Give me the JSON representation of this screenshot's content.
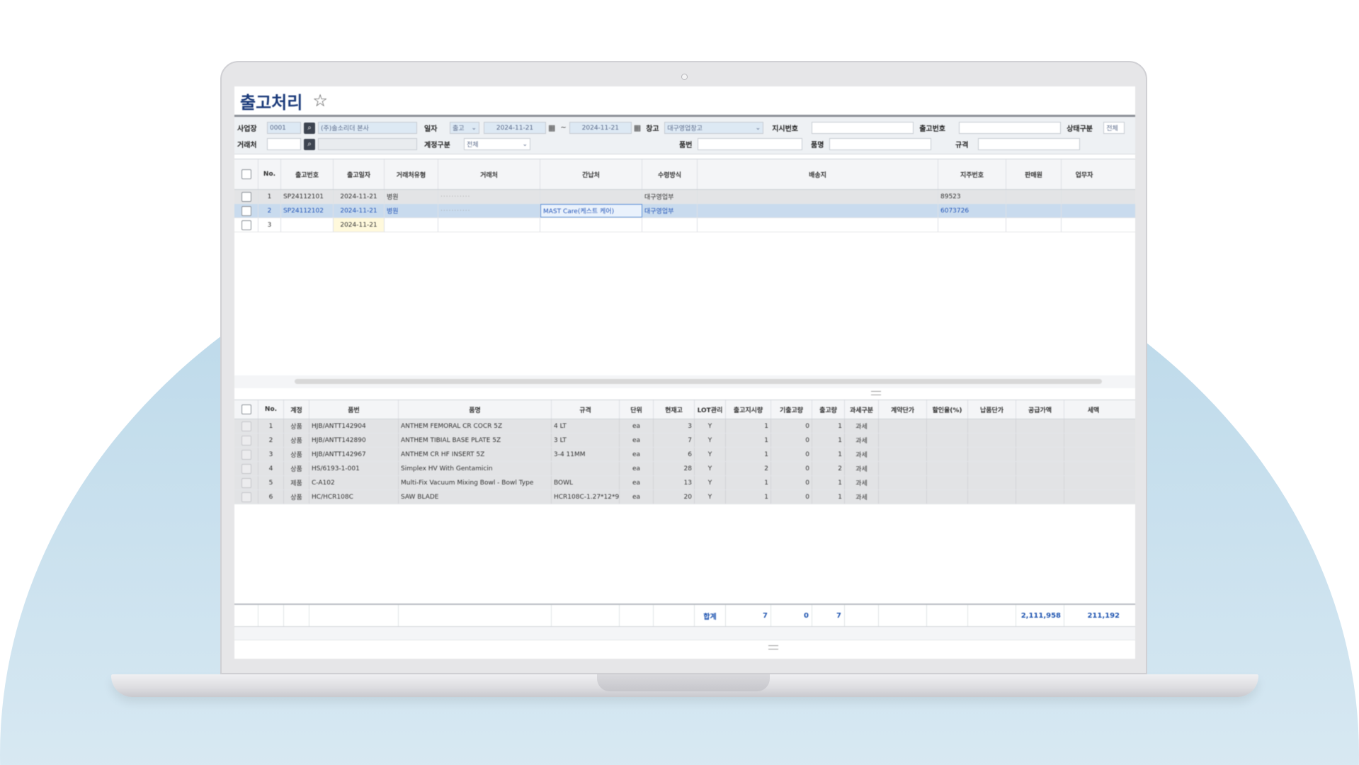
{
  "page": {
    "title": "출고처리",
    "star_icon": "star-icon"
  },
  "filters": {
    "row1": {
      "site_label": "사업장",
      "site_code": "0001",
      "site_name": "(주)솔소리더 본사",
      "date_label": "일자",
      "date_type": "출고",
      "date_from": "2024-11-21",
      "date_sep": "~",
      "date_to": "2024-11-21",
      "warehouse_label": "창고",
      "warehouse_value": "대구영업창고",
      "instruction_no_label": "지시번호",
      "instruction_no_value": "",
      "ship_no_label": "출고번호",
      "ship_no_value": "",
      "status_label": "상태구분",
      "status_value": "전체"
    },
    "row2": {
      "client_label": "거래처",
      "client_value": "",
      "account_label": "계정구분",
      "account_value": "전체",
      "item_no_label": "품번",
      "item_no_value": "",
      "item_name_label": "품명",
      "item_name_value": "",
      "spec_label": "규격",
      "spec_value": ""
    }
  },
  "master_grid": {
    "columns": [
      "No.",
      "출고번호",
      "출고일자",
      "거래처유형",
      "거래처",
      "간납처",
      "수령방식",
      "배송지",
      "지주번호",
      "판매원",
      "업무자"
    ],
    "rows": [
      {
        "no": "1",
        "ship_no": "SP24112101",
        "date": "2024-11-21",
        "type": "병원",
        "client": "···········",
        "agent": "",
        "method": "대구영업부",
        "address": "",
        "ref": "89523",
        "seller": "",
        "worker": ""
      },
      {
        "no": "2",
        "ship_no": "SP24112102",
        "date": "2024-11-21",
        "type": "병원",
        "client": "···········",
        "agent": "MAST Care(케스트 케어)",
        "method": "대구영업부",
        "address": "",
        "ref": "6073726",
        "seller": "",
        "worker": ""
      },
      {
        "no": "3",
        "ship_no": "",
        "date": "2024-11-21",
        "type": "",
        "client": "",
        "agent": "",
        "method": "",
        "address": "",
        "ref": "",
        "seller": "",
        "worker": ""
      }
    ]
  },
  "detail_grid": {
    "columns": [
      "No.",
      "계정",
      "품번",
      "품명",
      "규격",
      "단위",
      "현재고",
      "LOT관리",
      "출고지시량",
      "기출고량",
      "출고량",
      "과세구분",
      "계약단가",
      "할인율(%)",
      "납품단가",
      "공급가액",
      "세액"
    ],
    "rows": [
      {
        "no": "1",
        "acct": "상품",
        "item_no": "HJB/ANTT142904",
        "name": "ANTHEM FEMORAL CR COCR 5Z",
        "spec": "4 LT",
        "unit": "ea",
        "stock": "3",
        "lot": "Y",
        "ordered": "1",
        "shipped": "0",
        "qty": "1",
        "tax": "과세"
      },
      {
        "no": "2",
        "acct": "상품",
        "item_no": "HJB/ANTT142890",
        "name": "ANTHEM TIBIAL BASE PLATE 5Z",
        "spec": "3 LT",
        "unit": "ea",
        "stock": "7",
        "lot": "Y",
        "ordered": "1",
        "shipped": "0",
        "qty": "1",
        "tax": "과세"
      },
      {
        "no": "3",
        "acct": "상품",
        "item_no": "HJB/ANTT142967",
        "name": "ANTHEM CR HF INSERT 5Z",
        "spec": "3-4 11MM",
        "unit": "ea",
        "stock": "6",
        "lot": "Y",
        "ordered": "1",
        "shipped": "0",
        "qty": "1",
        "tax": "과세"
      },
      {
        "no": "4",
        "acct": "상품",
        "item_no": "HS/6193-1-001",
        "name": "Simplex HV With Gentamicin",
        "spec": "",
        "unit": "ea",
        "stock": "28",
        "lot": "Y",
        "ordered": "2",
        "shipped": "0",
        "qty": "2",
        "tax": "과세"
      },
      {
        "no": "5",
        "acct": "제품",
        "item_no": "C-A102",
        "name": "Multi-Fix Vacuum Mixing Bowl - Bowl Type",
        "spec": "BOWL",
        "unit": "ea",
        "stock": "13",
        "lot": "Y",
        "ordered": "1",
        "shipped": "0",
        "qty": "1",
        "tax": "과세"
      },
      {
        "no": "6",
        "acct": "상품",
        "item_no": "HC/HCR108C",
        "name": "SAW BLADE",
        "spec": "HCR108C-1.27*12*90",
        "unit": "ea",
        "stock": "20",
        "lot": "Y",
        "ordered": "1",
        "shipped": "0",
        "qty": "1",
        "tax": "과세"
      }
    ],
    "footer": {
      "label": "합계",
      "ordered": "7",
      "shipped": "0",
      "qty": "7",
      "supply": "2,111,958",
      "tax": "211,192"
    }
  },
  "colors": {
    "title": "#1a3a7a",
    "selected_row": "#c9dbee",
    "link_blue": "#2456b8"
  }
}
